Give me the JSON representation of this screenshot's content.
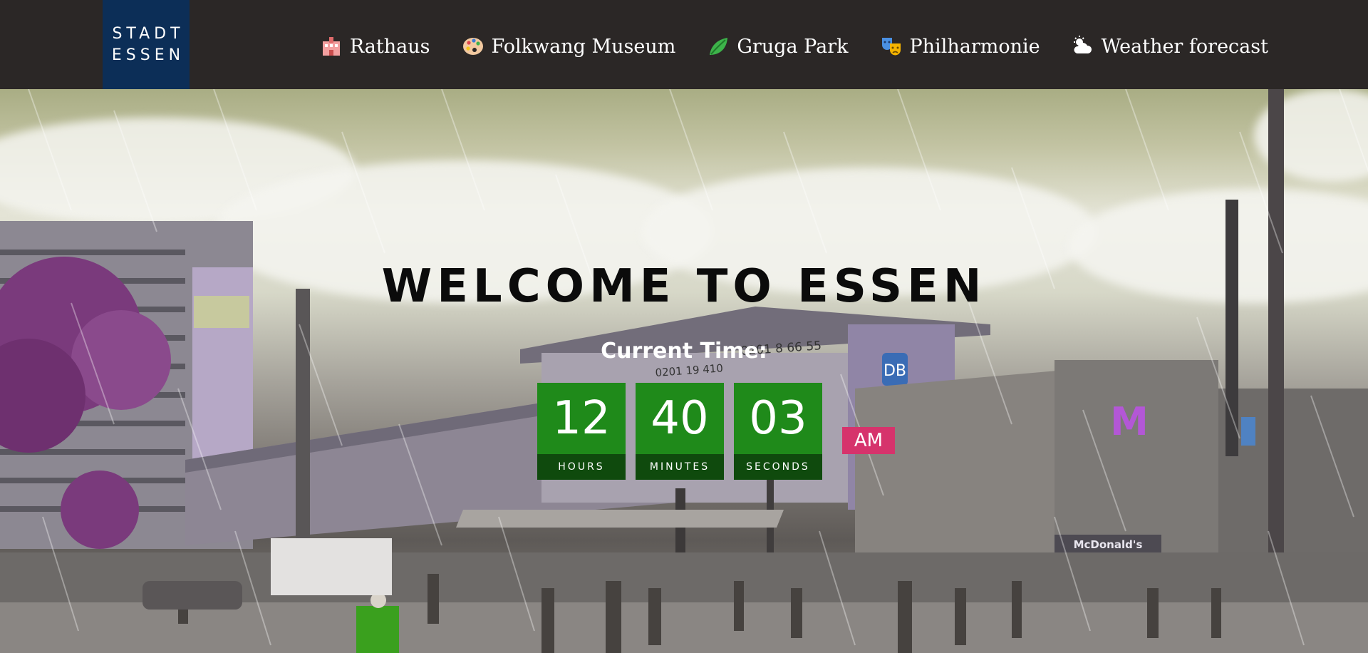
{
  "logo": {
    "line1": "STADT",
    "line2": "ESSEN"
  },
  "nav": [
    {
      "label": "Rathaus",
      "icon": "town-hall-icon"
    },
    {
      "label": "Folkwang Museum",
      "icon": "palette-icon"
    },
    {
      "label": "Gruga Park",
      "icon": "leaf-icon"
    },
    {
      "label": "Philharmonie",
      "icon": "theater-masks-icon"
    },
    {
      "label": "Weather forecast",
      "icon": "cloud-sun-icon"
    }
  ],
  "hero": {
    "title": "WELCOME TO ESSEN",
    "time_label": "Current Time:",
    "clock": {
      "hours": "12",
      "hours_label": "HOURS",
      "minutes": "40",
      "minutes_label": "MINUTES",
      "seconds": "03",
      "seconds_label": "SECONDS",
      "period": "AM"
    },
    "signs": {
      "station": "DB",
      "restaurant": "McDonald's",
      "phone": "0201 8 66 55",
      "phone2": "0201 19 410"
    }
  },
  "colors": {
    "header_bg": "#2b2726",
    "logo_bg": "#0c2e57",
    "clock_green": "#1f8a1a",
    "clock_label_bg": "#0f4a0d",
    "ampm_pink": "#d6336c"
  }
}
